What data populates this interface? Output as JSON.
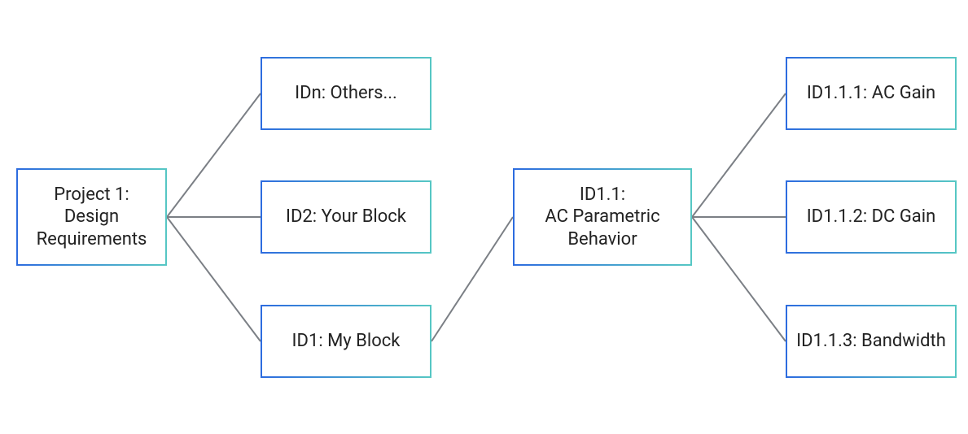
{
  "diagram": {
    "nodes": {
      "root": "Project 1:\nDesign\nRequirements",
      "idn": "IDn: Others...",
      "id2": "ID2: Your Block",
      "id1": "ID1: My Block",
      "id1_1": "ID1.1:\nAC Parametric\nBehavior",
      "id1_1_1": "ID1.1.1: AC Gain",
      "id1_1_2": "ID1.1.2: DC Gain",
      "id1_1_3": "ID1.1.3: Bandwidth"
    },
    "edges": [
      [
        "root",
        "idn"
      ],
      [
        "root",
        "id2"
      ],
      [
        "root",
        "id1"
      ],
      [
        "id1",
        "id1_1"
      ],
      [
        "id1_1",
        "id1_1_1"
      ],
      [
        "id1_1",
        "id1_1_2"
      ],
      [
        "id1_1",
        "id1_1_3"
      ]
    ]
  }
}
